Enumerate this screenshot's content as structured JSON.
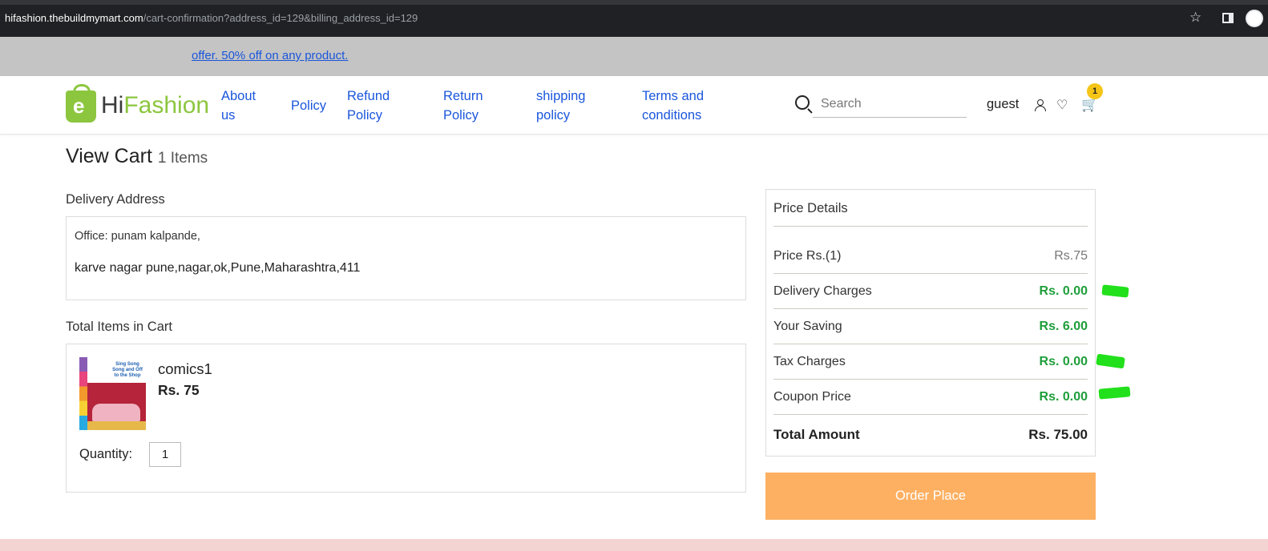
{
  "browser": {
    "url_host": "hifashion.thebuildmymart.com",
    "url_path": "/cart-confirmation?address_id=129&billing_address_id=129"
  },
  "offer": {
    "text": "offer. 50% off on any product."
  },
  "header": {
    "logo_letter": "e",
    "logo_hi": "Hi",
    "logo_fashion": "Fashion",
    "nav": {
      "about_l1": "About",
      "about_l2": "us",
      "policy": "Policy",
      "refund_l1": "Refund",
      "refund_l2": "Policy",
      "return_l1": "Return",
      "return_l2": "Policy",
      "shipping_l1": "shipping",
      "shipping_l2": "policy",
      "terms_l1": "Terms and",
      "terms_l2": "conditions"
    },
    "search_placeholder": "Search",
    "user_label": "guest",
    "cart_count": "1"
  },
  "page": {
    "title": "View Cart",
    "item_count": "1 Items",
    "delivery_label": "Delivery Address",
    "address_line1": "Office: punam kalpande,",
    "address_line2": "karve nagar pune,nagar,ok,Pune,Maharashtra,411",
    "items_label": "Total Items in Cart",
    "item": {
      "name": "comics1",
      "price": "Rs. 75",
      "quantity_label": "Quantity:",
      "quantity": "1",
      "cover_text": "Sing Song Song and Off to the Shop"
    }
  },
  "price_details": {
    "title": "Price Details",
    "rows": [
      {
        "label": "Price Rs.(1)",
        "value": "Rs.75"
      },
      {
        "label": "Delivery Charges",
        "value": "Rs. 0.00"
      },
      {
        "label": "Your Saving",
        "value": "Rs. 6.00"
      },
      {
        "label": "Tax Charges",
        "value": "Rs. 0.00"
      },
      {
        "label": "Coupon Price",
        "value": "Rs. 0.00"
      }
    ],
    "total_label": "Total Amount",
    "total_value": "Rs. 75.00",
    "order_button": "Order Place"
  },
  "colors": {
    "accent_blue": "#1a56db",
    "brand_green": "#8cc63f",
    "value_green": "#1e9e3a",
    "order_button": "#fdb062",
    "annotation_marks": "#22e01b"
  }
}
